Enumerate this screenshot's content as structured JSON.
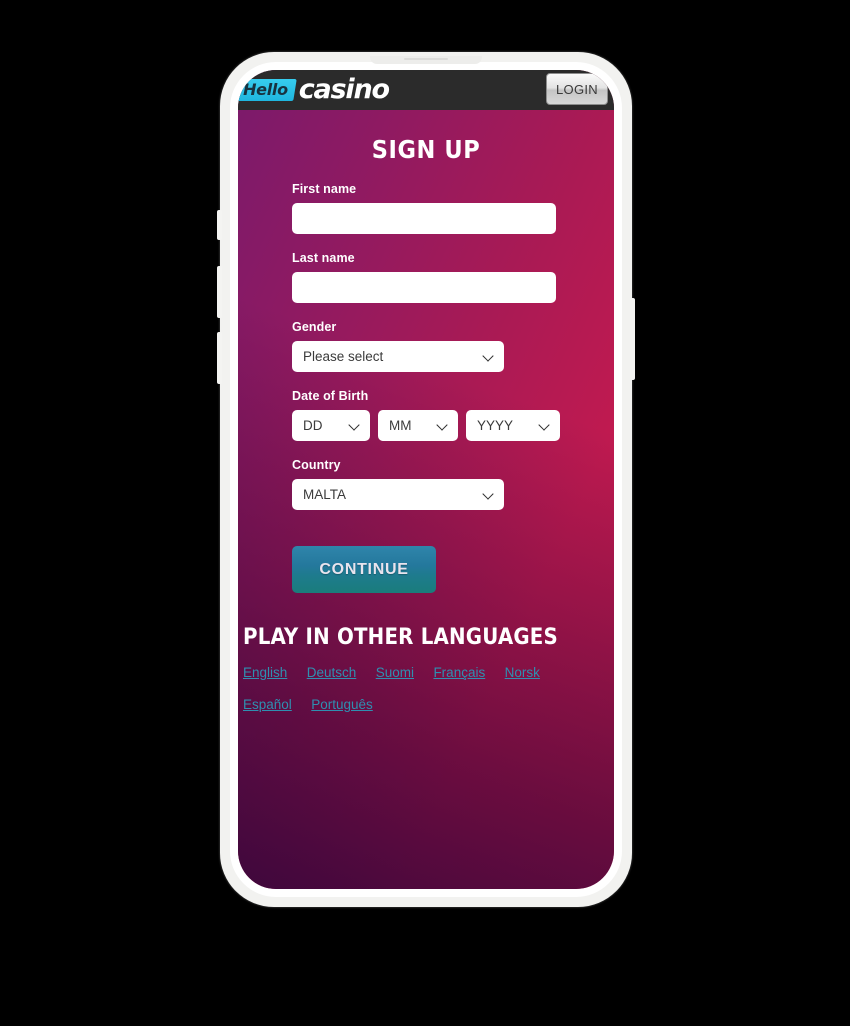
{
  "header": {
    "logo_hello": "Hello",
    "logo_casino": "casino",
    "login_label": "LOGIN"
  },
  "page": {
    "title": "SIGN UP"
  },
  "form": {
    "first_name": {
      "label": "First name",
      "value": "",
      "placeholder": ""
    },
    "last_name": {
      "label": "Last name",
      "value": "",
      "placeholder": ""
    },
    "gender": {
      "label": "Gender",
      "selected": "Please select"
    },
    "date_of_birth": {
      "label": "Date of Birth",
      "day": "DD",
      "month": "MM",
      "year": "YYYY"
    },
    "country": {
      "label": "Country",
      "selected": "MALTA"
    },
    "submit_label": "CONTINUE"
  },
  "languages": {
    "title": "PLAY IN OTHER LANGUAGES",
    "row1": [
      {
        "label": "English"
      },
      {
        "label": "Deutsch"
      },
      {
        "label": "Suomi"
      },
      {
        "label": "Français"
      },
      {
        "label": "Norsk"
      }
    ],
    "row2": [
      {
        "label": "Español"
      },
      {
        "label": "Português"
      }
    ]
  },
  "colors": {
    "screen_gradient_start": "#7a1a6c",
    "screen_gradient_end": "#bf1a4d",
    "header_bar": "#2b2b2b",
    "logo_badge": "#1fb6df",
    "continue_button": "#24789c",
    "link": "#2f8fb0",
    "phone_frame": "#f2f2f0"
  }
}
